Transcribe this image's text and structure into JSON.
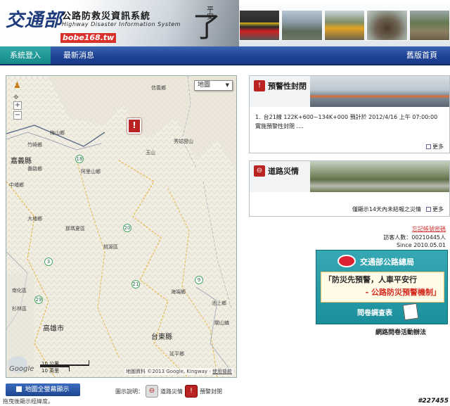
{
  "header": {
    "logo_text": "交通部",
    "title": "公路防救災資訊系統",
    "subtitle": "Highway Disaster Information System",
    "hash_label": "bobe168.tw",
    "peace_glyph": "了",
    "peace_small": "平安"
  },
  "nav": {
    "login": "系統登入",
    "news": "最新消息",
    "home": "舊版首頁"
  },
  "map": {
    "type_select": "地圖",
    "places": {
      "xinyi": "信義鄉",
      "meishan": "梅山鄉",
      "zhuqi": "竹崎鄉",
      "chiayi": "嘉義縣",
      "fanlu": "番路鄉",
      "alishan": "阿里山鄉",
      "yushan": "玉山",
      "xiugulan": "秀姑巒山",
      "zhongpu": "中埔鄉",
      "dapu": "大埔鄉",
      "namaxia": "那瑪夏區",
      "taoyuan": "桃源區",
      "haiduan": "海端鄉",
      "nanhua": "南化區",
      "shanlin": "杉林區",
      "kaohsiung": "高雄市",
      "taitung": "台東縣",
      "yanping": "延平鄉",
      "chishang": "池上鄉",
      "guanshan": "關山鎮",
      "jialong": "嘉義"
    },
    "roads": [
      "18",
      "20",
      "21",
      "3",
      "29",
      "9"
    ],
    "scale_km": "10 公里",
    "scale_mi": "10 英里",
    "google": "Google",
    "copyright": "地圖資料 ©2013 Google, Kingway -",
    "terms": "使用條款"
  },
  "map_footer": {
    "fullscreen": "地圖全螢幕顯示",
    "legend_label": "圖示說明：",
    "legend_disaster": "道路災情",
    "legend_warning": "預警封閉",
    "drag_hint": "拖曳後顯示經緯度。"
  },
  "panels": {
    "warning": {
      "title": "預警性封閉",
      "item_num": "1.",
      "item_text": "台21線 122K+600~134K+000 預計於 2012/4/16 上午 07:00:00 實施預警性封閉 ....",
      "more": "更多"
    },
    "disaster": {
      "title": "道路災情",
      "note": "僅顯示14天內未結報之災情",
      "more": "更多"
    }
  },
  "sidebar": {
    "forgot": "忘記帳號密碼",
    "visitors": "訪客人數：00210445人",
    "since": "Since 2010.05.01"
  },
  "survey": {
    "org": "交通部公路總局",
    "slogan1": "「防災先預警，人車平安行",
    "slogan2": "- 公路防災預警機制」",
    "cta": "問卷調查表",
    "caption": "網路問卷活動辦法"
  },
  "watermark": "#227455"
}
